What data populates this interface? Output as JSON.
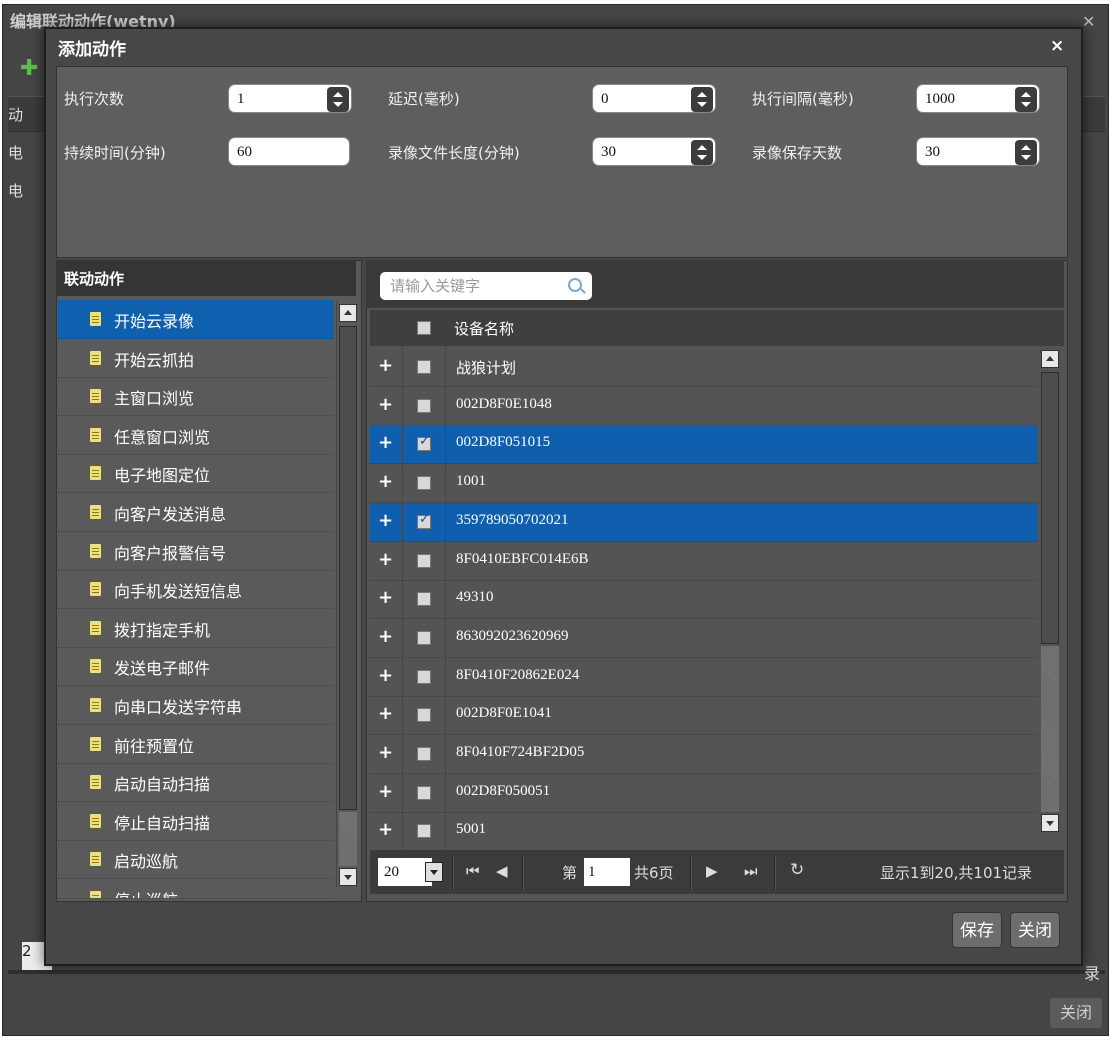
{
  "outer": {
    "title": "编辑联动动作(wetny)",
    "rows": [
      "动",
      "电",
      "电"
    ],
    "page_box": "2",
    "records_suffix": "录",
    "close_label": "关闭"
  },
  "modal": {
    "title": "添加动作",
    "close_glyph": "×"
  },
  "form": {
    "exec_count_label": "执行次数",
    "exec_count": "1",
    "delay_label": "延迟(毫秒)",
    "delay": "0",
    "exec_interval_label": "执行间隔(毫秒)",
    "exec_interval": "1000",
    "duration_label": "持续时间(分钟)",
    "duration": "60",
    "record_length_label": "录像文件长度(分钟)",
    "record_length": "30",
    "record_days_label": "录像保存天数",
    "record_days": "30"
  },
  "actions": {
    "header": "联动动作",
    "items": [
      "开始云录像",
      "开始云抓拍",
      "主窗口浏览",
      "任意窗口浏览",
      "电子地图定位",
      "向客户发送消息",
      "向客户报警信号",
      "向手机发送短信息",
      "拨打指定手机",
      "发送电子邮件",
      "向串口发送字符串",
      "前往预置位",
      "启动自动扫描",
      "停止自动扫描",
      "启动巡航",
      "停止巡航"
    ],
    "selected_index": 0
  },
  "devices": {
    "search_placeholder": "请输入关键字",
    "column_header": "设备名称",
    "rows": [
      {
        "name": "战狼计划",
        "checked": false
      },
      {
        "name": "002D8F0E1048",
        "checked": false
      },
      {
        "name": "002D8F051015",
        "checked": true
      },
      {
        "name": "1001",
        "checked": false
      },
      {
        "name": "359789050702021",
        "checked": true
      },
      {
        "name": "8F0410EBFC014E6B",
        "checked": false
      },
      {
        "name": "49310",
        "checked": false
      },
      {
        "name": "863092023620969",
        "checked": false
      },
      {
        "name": "8F0410F20862E024",
        "checked": false
      },
      {
        "name": "002D8F0E1041",
        "checked": false
      },
      {
        "name": "8F0410F724BF2D05",
        "checked": false
      },
      {
        "name": "002D8F050051",
        "checked": false
      },
      {
        "name": "5001",
        "checked": false
      }
    ]
  },
  "pager": {
    "page_size": "20",
    "page_prefix": "第",
    "page": "1",
    "total_pages": "共6页",
    "summary": "显示1到20,共101记录"
  },
  "buttons": {
    "save": "保存",
    "close": "关闭"
  },
  "icons": {
    "add": "plus-icon",
    "search": "search-icon",
    "first": "first-page-icon",
    "prev": "prev-page-icon",
    "next": "next-page-icon",
    "last": "last-page-icon",
    "refresh": "refresh-icon",
    "doc": "document-icon"
  }
}
